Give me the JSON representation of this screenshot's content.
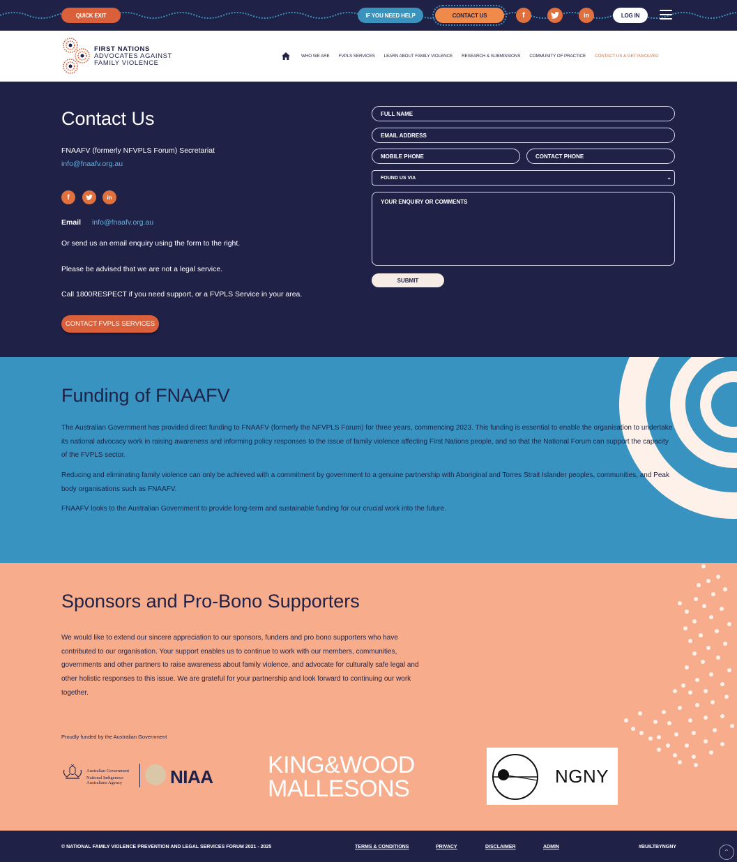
{
  "topbar": {
    "quick_exit": "QUICK EXIT",
    "need_help": "IF YOU NEED HELP",
    "contact_us": "CONTACT US",
    "login": "LOG IN",
    "social": [
      {
        "icon": "facebook-icon",
        "glyph": "f"
      },
      {
        "icon": "twitter-icon",
        "glyph": "t"
      },
      {
        "icon": "linkedin-icon",
        "glyph": "in"
      }
    ]
  },
  "logo": {
    "line1": "FIRST NATIONS",
    "line2": "ADVOCATES AGAINST",
    "line3": "FAMILY VIOLENCE"
  },
  "nav": {
    "home_icon": "home-icon",
    "items": [
      "WHO WE ARE",
      "FVPLS SERVICES",
      "LEARN ABOUT FAMILY VIOLENCE",
      "RESEARCH & SUBMISSIONS",
      "COMMUNITY OF PRACTICE",
      "CONTACT US & GET INVOLVED"
    ]
  },
  "contact": {
    "title": "Contact Us",
    "secretariat": "FNAAFV (formerly NFVPLS Forum) Secretariat",
    "secretariat_email": "info@fnaafv.org.au",
    "email_label": "Email",
    "email_value": "info@fnaafv.org.au",
    "para1": "Or send us an email enquiry using the form to the right.",
    "para2": "Please be advised that we are not a legal service.",
    "para3": "Call 1800RESPECT if you need support, or a FVPLS Service in your area.",
    "cta": "CONTACT FVPLS SERVICES"
  },
  "form": {
    "full_name": "FULL NAME",
    "email": "EMAIL ADDRESS",
    "mobile": "MOBILE PHONE",
    "contact_phone": "CONTACT PHONE",
    "found_via": "FOUND US VIA",
    "enquiry": "YOUR ENQUIRY OR COMMENTS",
    "submit": "SUBMIT"
  },
  "funding": {
    "title": "Funding of FNAAFV",
    "p1": "The Australian Government has provided direct funding to FNAAFV (formerly the NFVPLS Forum) for three years, commencing 2023. This funding is essential to enable the organisation to undertake its national advocacy work in raising awareness and informing policy responses to the issue of family violence affecting First Nations people, and so that the National Forum can support the capacity of the FVPLS sector.",
    "p2": "Reducing and eliminating family violence can only be achieved with a commitment by government to a genuine partnership with Aboriginal and Torres Strait Islander peoples, communities, and Peak body organisations such as FNAAFV.",
    "p3": "FNAAFV looks to the Australian Government to provide long-term and sustainable funding for our crucial work into the future."
  },
  "sponsors": {
    "title": "Sponsors and Pro-Bono Supporters",
    "body": "We would like to extend our sincere appreciation to our sponsors, funders and pro bono supporters who have contributed to our organisation. Your support enables us to continue to work with our members, communities, governments and other partners to raise awareness about family violence, and advocate for culturally safe legal and other holistic responses to this issue. We are grateful for your partnership and look forward to continuing our work together.",
    "funded_by": "Proudly funded by the Australian Government",
    "gov_line1": "Australian Government",
    "gov_line2": "National Indigenous",
    "gov_line3": "Australians Agency",
    "niaa": "NIAA",
    "kwm_line1": "KING&WOOD",
    "kwm_line2": "MALLESONS",
    "ngny": "NGNY"
  },
  "footer": {
    "copyright": "© NATIONAL FAMILY VIOLENCE PREVENTION AND LEGAL SERVICES FORUM 2021 - 2025",
    "terms": "TERMS & CONDITIONS",
    "privacy": "PRIVACY",
    "disclaimer": "DISCLAIMER",
    "admin": "ADMIN",
    "built": "#BUILTBYNGNY"
  },
  "colors": {
    "navy": "#1f2147",
    "orange": "#e0703e",
    "blue": "#3893c0",
    "peach": "#f7ad8b",
    "cream": "#fdf1ea"
  }
}
